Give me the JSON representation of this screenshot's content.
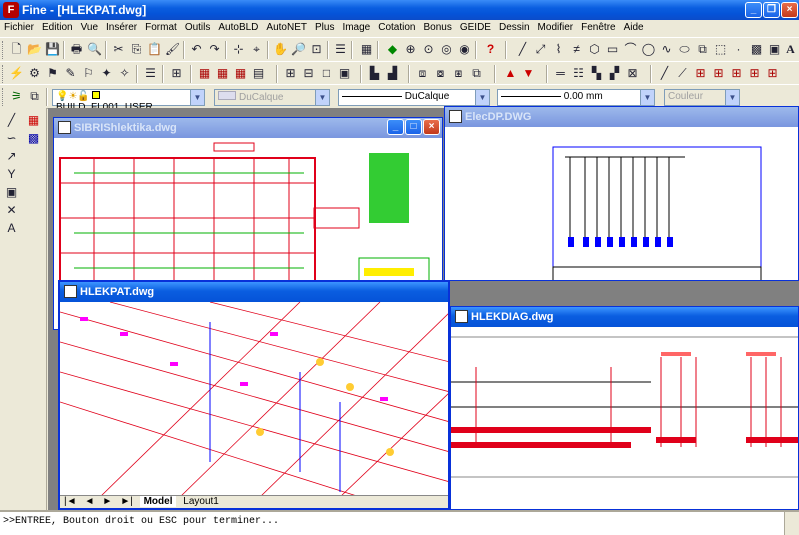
{
  "app": {
    "title": "Fine - [HLEKPAT.dwg]",
    "icon_letter": "F",
    "window_buttons": [
      "_",
      "❐",
      "×"
    ]
  },
  "menu": [
    "Fichier",
    "Edition",
    "Vue",
    "Insérer",
    "Format",
    "Outils",
    "AutoBLD",
    "AutoNET",
    "Plus",
    "Image",
    "Cotation",
    "Bonus",
    "GEIDE",
    "Dessin",
    "Modifier",
    "Fenêtre",
    "Aide"
  ],
  "properties": {
    "layer_name": "BUILD_FL001_USER",
    "color_combo": "DuCalque",
    "linetype_combo": "DuCalque",
    "lineweight_combo": "0.00 mm",
    "plotstyle_combo": "Couleur"
  },
  "windows": {
    "sibrishlektika": {
      "title": "SIBRIShlektika.dwg"
    },
    "elecdp": {
      "title": "ElecDP.DWG"
    },
    "hlekpat": {
      "title": "HLEKPAT.dwg",
      "tabs": [
        "Model",
        "Layout1"
      ]
    },
    "hlekdiag": {
      "title": "HLEKDIAG.dwg"
    }
  },
  "command_line": {
    "text": ">>ENTREE, Bouton droit ou ESC pour terminer..."
  },
  "colors": {
    "titlebar": "#0553d8",
    "drawing_red": "#e0001a",
    "drawing_green": "#00b000",
    "drawing_blue": "#0000ff",
    "magenta": "#ff00ff"
  }
}
